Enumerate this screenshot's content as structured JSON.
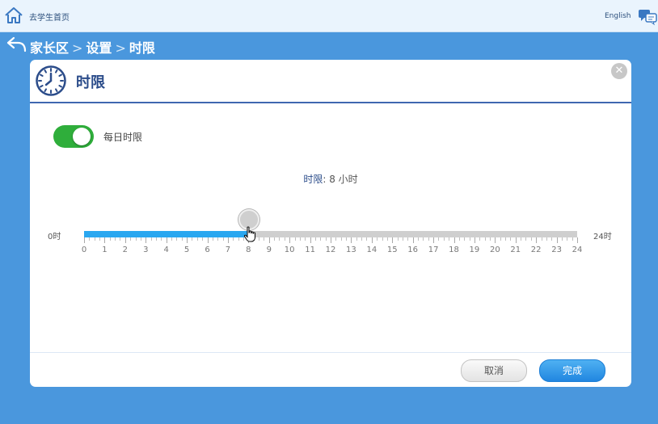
{
  "topbar": {
    "home_label": "去学生首页",
    "lang_label": "English"
  },
  "breadcrumb": {
    "items": [
      "家长区",
      "设置",
      "时限"
    ],
    "separator": ">"
  },
  "dialog": {
    "title": "时限",
    "close_glyph": "✕",
    "daily_toggle": {
      "label": "每日时限",
      "on": true
    },
    "limit": {
      "prefix": "时限",
      "value_text": ": 8 小时"
    },
    "slider": {
      "min_label": "0时",
      "max_label": "24时",
      "min": 0,
      "max": 24,
      "value": 8,
      "tick_labels": [
        "0",
        "1",
        "2",
        "3",
        "4",
        "5",
        "6",
        "7",
        "8",
        "9",
        "10",
        "11",
        "12",
        "13",
        "14",
        "15",
        "16",
        "17",
        "18",
        "19",
        "20",
        "21",
        "22",
        "23",
        "24"
      ]
    },
    "buttons": {
      "cancel": "取消",
      "done": "完成"
    }
  },
  "colors": {
    "background": "#4a97dd",
    "accent": "#2b4c8a",
    "toggle_on": "#2fae3b",
    "slider_fill": "#2aa7f0",
    "done_button": "#2186e0"
  },
  "icons": [
    "home-icon",
    "language-icon",
    "back-arrow-icon",
    "clock-icon",
    "close-icon",
    "hand-cursor-icon"
  ]
}
